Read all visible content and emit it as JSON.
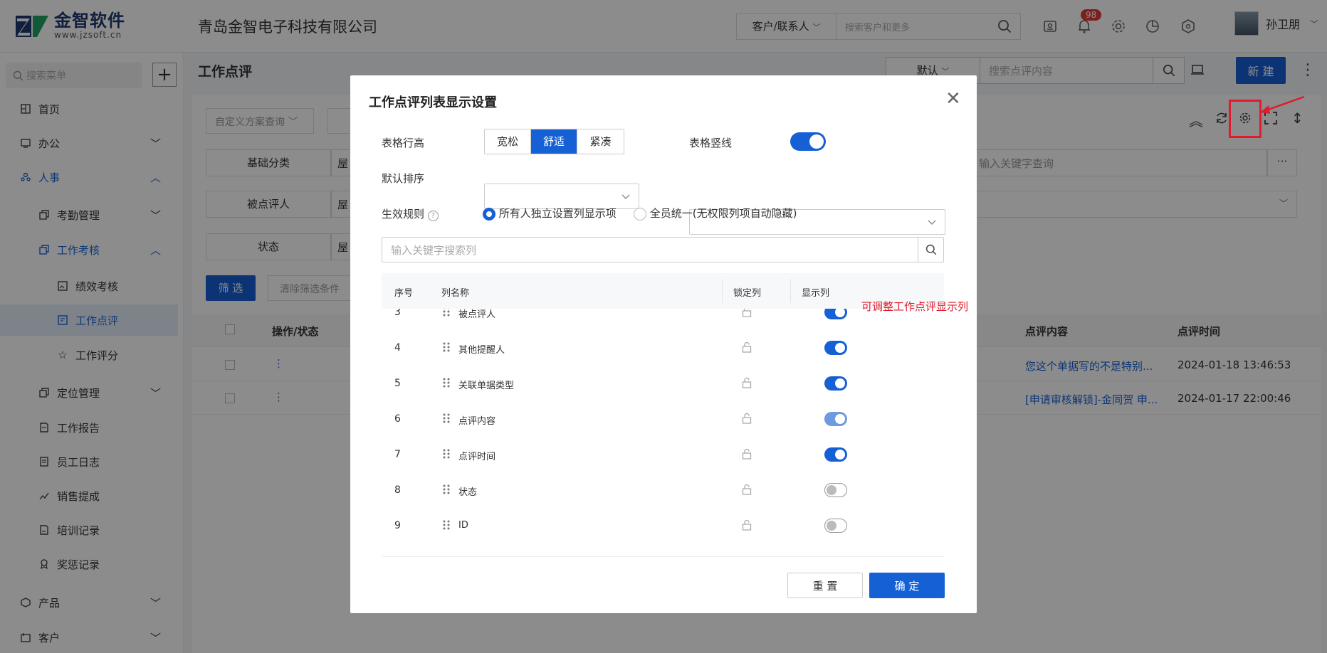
{
  "header": {
    "logo_name": "金智软件",
    "logo_url": "www.jzsoft.cn",
    "company": "青岛金智电子科技有限公司",
    "search_type": "客户/联系人",
    "search_placeholder": "搜索客户和更多",
    "notification_count": "98",
    "user_name": "孙卫朋"
  },
  "sidebar": {
    "search_placeholder": "搜索菜单",
    "items": [
      {
        "label": "首页",
        "icon": "home-grid-icon"
      },
      {
        "label": "办公",
        "icon": "office-icon"
      },
      {
        "label": "人事",
        "icon": "people-icon"
      },
      {
        "label": "考勤管理",
        "icon": "copy-icon"
      },
      {
        "label": "工作考核",
        "icon": "copy-icon"
      },
      {
        "label": "绩效考核",
        "icon": "image-icon"
      },
      {
        "label": "工作点评",
        "icon": "comment-icon"
      },
      {
        "label": "工作评分",
        "icon": "star-icon"
      },
      {
        "label": "定位管理",
        "icon": "copy-icon"
      },
      {
        "label": "工作报告",
        "icon": "report-icon"
      },
      {
        "label": "员工日志",
        "icon": "log-icon"
      },
      {
        "label": "销售提成",
        "icon": "chart-icon"
      },
      {
        "label": "培训记录",
        "icon": "training-icon"
      },
      {
        "label": "奖惩记录",
        "icon": "award-icon"
      },
      {
        "label": "产品",
        "icon": "box-icon"
      },
      {
        "label": "客户",
        "icon": "customer-icon"
      }
    ]
  },
  "page": {
    "title": "工作点评",
    "view_select": "默认",
    "search_placeholder": "搜索点评内容",
    "new_button": "新 建",
    "custom_query": "自定义方案查询",
    "filter_labels": [
      "基础分类",
      "被点评人",
      "状态"
    ],
    "filter_value_prefix": "屋",
    "keyword_placeholder": "输入关键字查询",
    "filter_button": "筛 选",
    "clear_button": "清除筛选条件",
    "table_headers": [
      "操作/状态",
      "点评内容",
      "点评时间"
    ],
    "rows": [
      {
        "content": "您这个单据写的不是特别...",
        "time": "2024-01-18 13:46:53"
      },
      {
        "content": "[申请审核解锁]-金同贺 申...",
        "time": "2024-01-17 22:00:46"
      }
    ]
  },
  "dialog": {
    "title": "工作点评列表显示设置",
    "row_height_label": "表格行高",
    "row_height_options": [
      "宽松",
      "舒适",
      "紧凑"
    ],
    "row_height_selected": 1,
    "vline_label": "表格竖线",
    "vline_on": true,
    "sort_label": "默认排序",
    "rule_label": "生效规则",
    "rule_options": [
      "所有人独立设置列显示项",
      "全员统一(无权限列项自动隐藏)"
    ],
    "rule_selected": 0,
    "search_placeholder": "输入关键字搜索列",
    "headers": {
      "no": "序号",
      "name": "列名称",
      "lock": "锁定列",
      "show": "显示列"
    },
    "columns": [
      {
        "no": "3",
        "name": "被点评人",
        "show": "on"
      },
      {
        "no": "4",
        "name": "其他提醒人",
        "show": "on"
      },
      {
        "no": "5",
        "name": "关联单据类型",
        "show": "on"
      },
      {
        "no": "6",
        "name": "点评内容",
        "show": "half"
      },
      {
        "no": "7",
        "name": "点评时间",
        "show": "on"
      },
      {
        "no": "8",
        "name": "状态",
        "show": "off"
      },
      {
        "no": "9",
        "name": "ID",
        "show": "off"
      }
    ],
    "reset_button": "重 置",
    "ok_button": "确 定"
  },
  "annotation": "可调整工作点评显示列",
  "colors": {
    "primary": "#1660d6",
    "annotation": "#e01b2c"
  }
}
